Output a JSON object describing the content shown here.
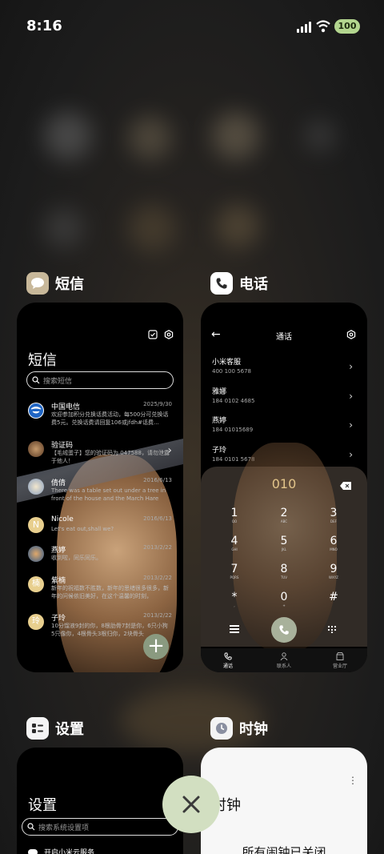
{
  "status_bar": {
    "time": "8:16",
    "battery": "100"
  },
  "sms_app": {
    "name": "短信",
    "title": "短信",
    "search_placeholder": "搜索短信",
    "messages": [
      {
        "name": "中国电信",
        "date": "2025/9/30",
        "text": "欢迎参加积分兑换话费活动，每500分可兑换话费5元。兑换话费请回复106或jfdh#话费..."
      },
      {
        "name": "验证码",
        "date": "",
        "text": "【毛绒蛋子】您的验证码为 047588，请勿泄露于他人！"
      },
      {
        "name": "倩倩",
        "date": "2016/6/13",
        "text": "There was a table set out under a tree in front of the house and the March Hare an..."
      },
      {
        "name": "Nicole",
        "date": "2016/6/13",
        "text": "Let's eat out,shall we?"
      },
      {
        "name": "燕婷",
        "date": "2013/2/22",
        "text": "收到啦，同乐同乐。"
      },
      {
        "name": "紫楠",
        "date": "2013/2/22",
        "text": "新年的祝福数不胜数，新年的思绪很多很多，新年的问候依旧美好，在这个温馨的时刻，"
      },
      {
        "name": "子玲",
        "date": "2013/2/22",
        "text": "10分馏液9封的你，8根肋骨7封是你，6只小狗5只像你，4根骨头3根归你，2块骨头"
      }
    ],
    "avatar_letters": {
      "nicole": "N",
      "zinan": "楠",
      "ziling": "玲"
    },
    "fab": "+"
  },
  "phone_app": {
    "name": "电话",
    "header": "通话",
    "contacts": [
      {
        "name": "小米客服",
        "number": "400 100 5678"
      },
      {
        "name": "雅娜",
        "number": "184 0102 4685"
      },
      {
        "name": "燕婷",
        "number": "184 01015689"
      },
      {
        "name": "子玲",
        "number": "184 0101 5678"
      }
    ],
    "dialed": "010",
    "keys": [
      {
        "digit": "1",
        "letters": "QO"
      },
      {
        "digit": "2",
        "letters": "ABC"
      },
      {
        "digit": "3",
        "letters": "DEF"
      },
      {
        "digit": "4",
        "letters": "GHI"
      },
      {
        "digit": "5",
        "letters": "JKL"
      },
      {
        "digit": "6",
        "letters": "MNO"
      },
      {
        "digit": "7",
        "letters": "PQRS"
      },
      {
        "digit": "8",
        "letters": "TUV"
      },
      {
        "digit": "9",
        "letters": "WXYZ"
      },
      {
        "digit": "*",
        "letters": ","
      },
      {
        "digit": "0",
        "letters": "+"
      },
      {
        "digit": "#",
        "letters": ""
      }
    ],
    "tabs": [
      "通话",
      "联系人",
      "营业厅"
    ]
  },
  "settings_app": {
    "name": "设置",
    "title": "设置",
    "search_placeholder": "搜索系统设置项",
    "item": "开启小米云服务"
  },
  "clock_app": {
    "name": "时钟",
    "title": "时钟",
    "text": "所有闹钟已关闭"
  },
  "colors": {
    "accent_green": "#d2dfc1",
    "dial_gold": "#e2c48a"
  }
}
